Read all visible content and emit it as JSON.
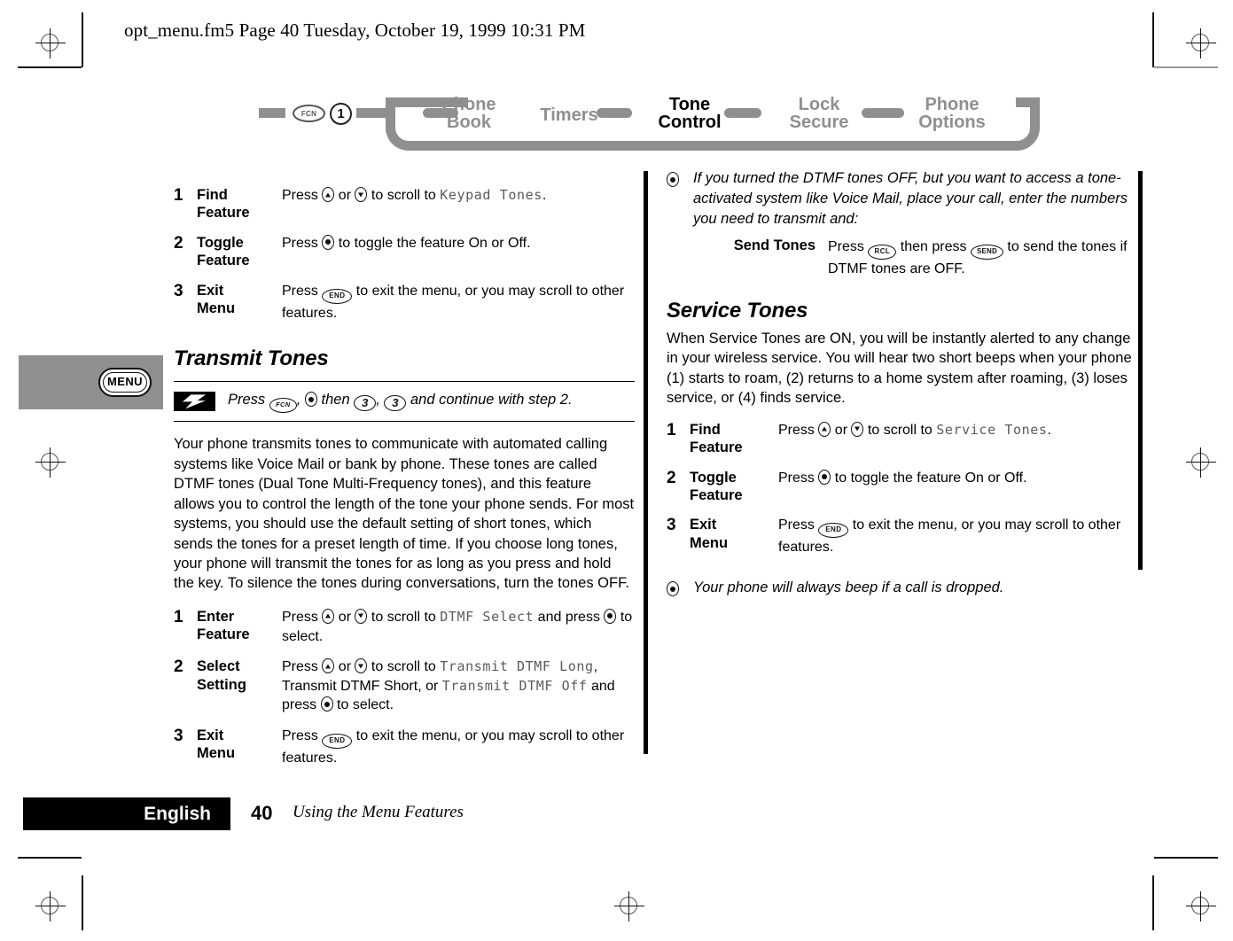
{
  "header": {
    "line": "opt_menu.fm5  Page 40  Tuesday, October 19, 1999  10:31 PM"
  },
  "breadcrumb": {
    "fcn_key": "FCN",
    "number_key": "1",
    "items": [
      {
        "label_line1": "Phone",
        "label_line2": "Book",
        "active": false
      },
      {
        "label_line1": "Timers",
        "label_line2": "",
        "active": false
      },
      {
        "label_line1": "Tone",
        "label_line2": "Control",
        "active": true
      },
      {
        "label_line1": "Lock",
        "label_line2": "Secure",
        "active": false
      },
      {
        "label_line1": "Phone",
        "label_line2": "Options",
        "active": false
      }
    ]
  },
  "margin_tab": {
    "button_label": "MENU"
  },
  "left_column": {
    "keypad_tones_steps": [
      {
        "num": "1",
        "label_line1": "Find",
        "label_line2": "Feature",
        "text_pre": "Press ",
        "text_mid": " or ",
        "text_post": " to scroll to ",
        "lcd": "Keypad Tones",
        "text_end": "."
      },
      {
        "num": "2",
        "label_line1": "Toggle",
        "label_line2": "Feature",
        "text_pre": "Press ",
        "text_post": " to toggle the feature On or Off."
      },
      {
        "num": "3",
        "label_line1": "Exit",
        "label_line2": "Menu",
        "text_pre": "Press ",
        "text_post": " to exit the menu, or you may scroll to other features."
      }
    ],
    "section_heading": "Transmit Tones",
    "shortcut": {
      "icon": "lightning-bolt-icon",
      "pre": "Press ",
      "fcn": "FCN",
      "mid": ", ",
      "then": " then ",
      "key_a": "3",
      "comma": ", ",
      "key_b": "3",
      "post": " and continue with step 2."
    },
    "body_paragraph": "Your phone transmits tones to communicate with automated calling systems like Voice Mail or bank by phone. These tones are called DTMF tones (Dual Tone Multi-Frequency tones), and this feature allows you to control the length of the tone your phone sends. For most systems, you should use the default setting of short tones, which sends the tones for a preset length of time. If you choose long tones, your phone will transmit the tones for as long as you press and hold the key. To silence the tones during conversations, turn the tones OFF.",
    "transmit_steps": [
      {
        "num": "1",
        "label_line1": "Enter",
        "label_line2": "Feature",
        "pre": "Press ",
        "mid": " or ",
        "post": " to scroll to ",
        "lcd1": "DTMF Select",
        "tail1": " and press ",
        "tail2": " to select."
      },
      {
        "num": "2",
        "label_line1": "Select",
        "label_line2": "Setting",
        "pre": "Press ",
        "mid": " or ",
        "post": " to scroll to ",
        "lcd1": "Transmit DTMF Long",
        "sep1": ", Transmit DTMF Short, or ",
        "lcd2": "Transmit DTMF Off",
        "tail1": " and press ",
        "tail2": " to select."
      },
      {
        "num": "3",
        "label_line1": "Exit",
        "label_line2": "Menu",
        "pre": "Press ",
        "post": " to exit the menu, or you may scroll to other features."
      }
    ]
  },
  "right_column": {
    "note_top": "If you turned the DTMF tones OFF, but you want to access a tone-activated system like Voice Mail, place your call, enter the numbers you need to transmit and:",
    "send_tones": {
      "label": "Send Tones",
      "pre": "Press ",
      "rcl_key": "RCL",
      "mid": " then press ",
      "send_key": "SEND",
      "post": " to send the tones if DTMF tones are OFF."
    },
    "section_heading": "Service Tones",
    "body_paragraph": "When Service Tones are ON, you will be instantly alerted to any change in your wireless service. You will hear two short beeps when your phone (1) starts to roam, (2) returns to a home system after roaming, (3) loses service, or (4) finds service.",
    "service_steps": [
      {
        "num": "1",
        "label_line1": "Find",
        "label_line2": "Feature",
        "pre": "Press ",
        "mid": " or ",
        "post": " to scroll to ",
        "lcd": "Service Tones",
        "tail": "."
      },
      {
        "num": "2",
        "label_line1": "Toggle",
        "label_line2": "Feature",
        "pre": "Press ",
        "post": " to toggle the feature On or Off."
      },
      {
        "num": "3",
        "label_line1": "Exit",
        "label_line2": "Menu",
        "pre": "Press ",
        "post": " to exit the menu, or you may scroll to other features."
      }
    ],
    "note_bottom": "Your phone will always beep if a call is dropped."
  },
  "footer": {
    "language": "English",
    "page_number": "40",
    "title": "Using the Menu Features"
  },
  "keys": {
    "end": "END",
    "rcl": "RCL",
    "send": "SEND",
    "fcn": "FCN",
    "three": "3"
  },
  "colors": {
    "breadcrumb_gray": "#8f8f8f",
    "lcd_gray": "#5a5a5a",
    "ink": "#000000"
  }
}
